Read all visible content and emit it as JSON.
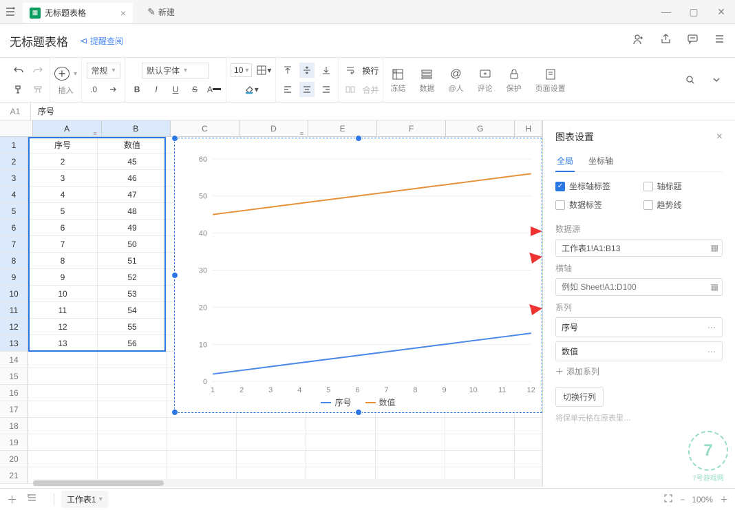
{
  "tab_title": "无标题表格",
  "new_tab": "新建",
  "doc_title": "无标题表格",
  "remind": "提醒查阅",
  "toolbar": {
    "insert": "插入",
    "normal": "常规",
    "decimal": ".0",
    "font": "默认字体",
    "size": "10",
    "wrap": "换行",
    "merge": "合并",
    "freeze": "冻结",
    "data": "数据",
    "mention": "@人",
    "comment": "评论",
    "protect": "保护",
    "page": "页面设置"
  },
  "addr": "A1",
  "formula": "序号",
  "columns": [
    "A",
    "B",
    "C",
    "D",
    "E",
    "F",
    "G",
    "H"
  ],
  "rows": [
    1,
    2,
    3,
    4,
    5,
    6,
    7,
    8,
    9,
    10,
    11,
    12,
    13,
    14,
    15,
    16,
    17,
    18,
    19,
    20,
    21
  ],
  "table_data": {
    "headers": [
      "序号",
      "数值"
    ],
    "rows": [
      [
        2,
        45
      ],
      [
        3,
        46
      ],
      [
        4,
        47
      ],
      [
        5,
        48
      ],
      [
        6,
        49
      ],
      [
        7,
        50
      ],
      [
        8,
        51
      ],
      [
        9,
        52
      ],
      [
        10,
        53
      ],
      [
        11,
        54
      ],
      [
        12,
        55
      ],
      [
        13,
        56
      ]
    ]
  },
  "chart_data": {
    "type": "line",
    "categories": [
      1,
      2,
      3,
      4,
      5,
      6,
      7,
      8,
      9,
      10,
      11,
      12
    ],
    "series": [
      {
        "name": "序号",
        "color": "#4a86e8",
        "values": [
          2,
          3,
          4,
          5,
          6,
          7,
          8,
          9,
          10,
          11,
          12,
          13
        ]
      },
      {
        "name": "数值",
        "color": "#e69138",
        "values": [
          45,
          46,
          47,
          48,
          49,
          50,
          51,
          52,
          53,
          54,
          55,
          56
        ]
      }
    ],
    "ylim": [
      0,
      60
    ],
    "yticks": [
      0,
      10,
      20,
      30,
      40,
      50,
      60
    ],
    "xticks": [
      1,
      2,
      3,
      4,
      5,
      6,
      7,
      8,
      9,
      10,
      11,
      12
    ],
    "legend": [
      "序号",
      "数值"
    ]
  },
  "panel": {
    "title": "图表设置",
    "tab_global": "全局",
    "tab_axis": "坐标轴",
    "check_axis_label": "坐标轴标签",
    "check_axis_title": "轴标题",
    "check_data_label": "数据标签",
    "check_trendline": "趋势线",
    "label_src": "数据源",
    "src_value": "工作表1!A1:B13",
    "label_xaxis": "横轴",
    "xaxis_placeholder": "例如 Sheet!A1:D100",
    "label_series": "系列",
    "series1": "序号",
    "series2": "数值",
    "add_series": "添加系列",
    "swap": "切换行列",
    "hint": "将保单元格在原表里…"
  },
  "footer": {
    "sheet": "工作表1",
    "zoom": "100%"
  }
}
